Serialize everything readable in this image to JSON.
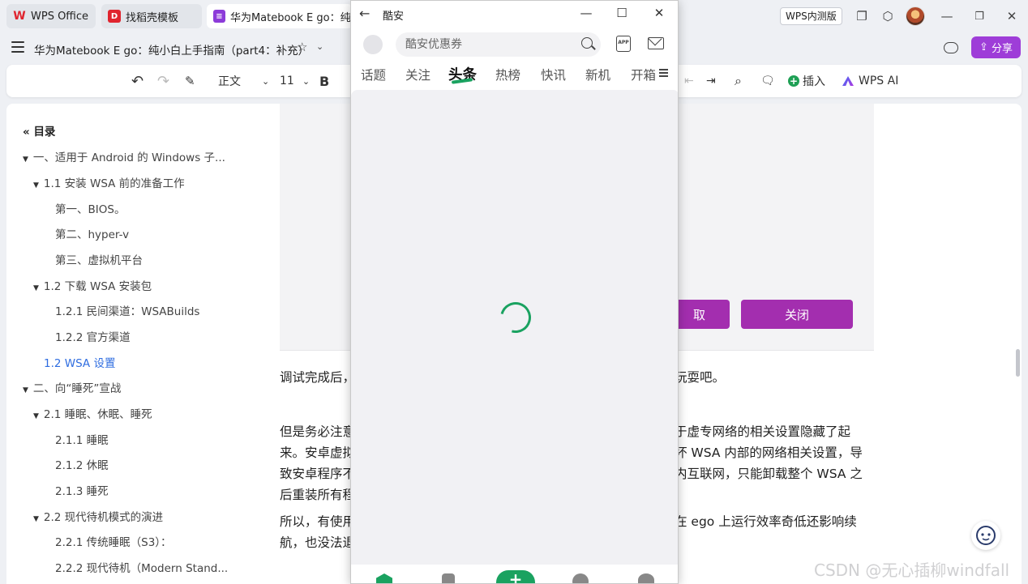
{
  "titlebar": {
    "tabs": [
      {
        "label": "WPS Office"
      },
      {
        "label": "找稻壳模板"
      },
      {
        "label": "华为Matebook E go：纯小"
      }
    ],
    "beta_label": "WPS内测版"
  },
  "docbar": {
    "title": "华为Matebook E go：纯小白上手指南（part4：补充）",
    "share_label": "分享"
  },
  "toolbar": {
    "style_value": "正文",
    "font_size_value": "11",
    "bold_label": "B",
    "insert_label": "插入",
    "wps_ai_label": "WPS AI"
  },
  "toc": {
    "title": "目录",
    "items": [
      {
        "label": "一、适用于 Android 的 Windows 子..."
      },
      {
        "label": "1.1 安装 WSA 前的准备工作"
      },
      {
        "label": "第一、BIOS。"
      },
      {
        "label": "第二、hyper-v"
      },
      {
        "label": "第三、虚拟机平台"
      },
      {
        "label": "1.2 下载 WSA 安装包"
      },
      {
        "label": "1.2.1 民间渠道：WSABuilds"
      },
      {
        "label": "1.2.2 官方渠道"
      },
      {
        "label": "1.2 WSA 设置"
      },
      {
        "label": "二、向“睡死”宣战"
      },
      {
        "label": "2.1 睡眠、休眠、睡死"
      },
      {
        "label": "2.1.1 睡眠"
      },
      {
        "label": "2.1.2 休眠"
      },
      {
        "label": "2.1.3 睡死"
      },
      {
        "label": "2.2 现代待机模式的演进"
      },
      {
        "label": "2.2.1 传统睡眠（S3）："
      },
      {
        "label": "2.2.2 现代待机（Modern Stand..."
      }
    ]
  },
  "document": {
    "figure_buttons": {
      "left": "取",
      "right": "关闭"
    },
    "paragraphs": {
      "p1_left": "调试完成后，",
      "p1_right": "玩耍吧。",
      "p2_left": [
        "但是务必注意",
        "来。安卓虚拟",
        "致安卓程序不",
        "后重装所有程"
      ],
      "p2_right": [
        "于虚专网络的相关设置隐藏了起",
        "坏 WSA 内部的网络相关设置，导",
        "内互联网，只能卸载整个 WSA 之",
        ""
      ],
      "p3_left": [
        "所以，有使用",
        "航，也没法退"
      ],
      "p3_right": [
        "在 ego 上运行效率奇低还影响续",
        ""
      ]
    },
    "watermark": "CSDN @无心插柳windfall"
  },
  "coolapk": {
    "title": "酷安",
    "search_placeholder": "酷安优惠券",
    "app_icon_text": "APP",
    "tabs": [
      {
        "label": "话题"
      },
      {
        "label": "关注"
      },
      {
        "label": "头条"
      },
      {
        "label": "热榜"
      },
      {
        "label": "快讯"
      },
      {
        "label": "新机"
      },
      {
        "label": "开箱"
      }
    ],
    "active_tab": "头条",
    "add_label": "+"
  },
  "colors": {
    "accent_purple": "#9e3dd8",
    "coolapk_green": "#1aa260",
    "link_blue": "#2f6de0",
    "figure_button": "#a32eaf"
  }
}
